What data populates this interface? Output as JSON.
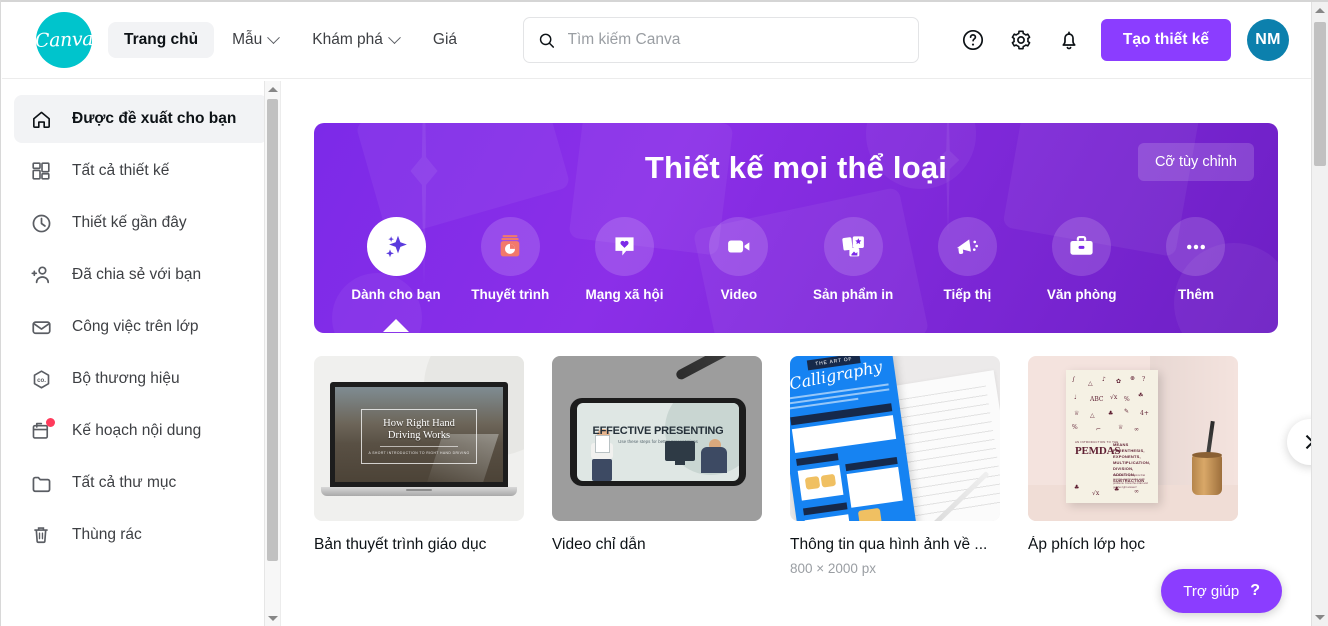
{
  "header": {
    "logo_text": "Canva",
    "nav": [
      {
        "label": "Trang chủ",
        "has_caret": false,
        "active": true
      },
      {
        "label": "Mẫu",
        "has_caret": true,
        "active": false
      },
      {
        "label": "Khám phá",
        "has_caret": true,
        "active": false
      },
      {
        "label": "Giá",
        "has_caret": false,
        "active": false
      }
    ],
    "search": {
      "placeholder": "Tìm kiếm Canva",
      "value": ""
    },
    "help_icon": "question-circle-icon",
    "settings_icon": "gear-icon",
    "notifications_icon": "bell-icon",
    "create_button": "Tạo thiết kế",
    "avatar_initials": "NM",
    "accent_color": "#8b3dff",
    "logo_color": "#00c4cc",
    "avatar_color": "#0c80ad"
  },
  "sidebar": {
    "items": [
      {
        "label": "Được đề xuất cho bạn",
        "icon": "home-icon",
        "active": true,
        "badge": false
      },
      {
        "label": "Tất cả thiết kế",
        "icon": "grid-icon",
        "active": false,
        "badge": false
      },
      {
        "label": "Thiết kế gần đây",
        "icon": "clock-icon",
        "active": false,
        "badge": false
      },
      {
        "label": "Đã chia sẻ với bạn",
        "icon": "add-person-icon",
        "active": false,
        "badge": false
      },
      {
        "label": "Công việc trên lớp",
        "icon": "inbox-icon",
        "active": false,
        "badge": false
      },
      {
        "label": "Bộ thương hiệu",
        "icon": "brand-kit-icon",
        "active": false,
        "badge": false
      },
      {
        "label": "Kế hoạch nội dung",
        "icon": "calendar-plus-icon",
        "active": false,
        "badge": true
      },
      {
        "label": "Tất cả thư mục",
        "icon": "folder-icon",
        "active": false,
        "badge": false
      },
      {
        "label": "Thùng rác",
        "icon": "trash-icon",
        "active": false,
        "badge": false
      }
    ],
    "badge_color": "#ff3b5c"
  },
  "banner": {
    "title": "Thiết kế mọi thể loại",
    "custom_size_button": "Cỡ tùy chỉnh",
    "categories": [
      {
        "label": "Dành cho bạn",
        "icon": "sparkle-icon",
        "selected": true
      },
      {
        "label": "Thuyết trình",
        "icon": "presentation-chart-icon",
        "selected": false
      },
      {
        "label": "Mạng xã hội",
        "icon": "heart-bubble-icon",
        "selected": false
      },
      {
        "label": "Video",
        "icon": "video-camera-icon",
        "selected": false
      },
      {
        "label": "Sản phẩm in",
        "icon": "print-cards-icon",
        "selected": false
      },
      {
        "label": "Tiếp thị",
        "icon": "megaphone-icon",
        "selected": false
      },
      {
        "label": "Văn phòng",
        "icon": "briefcase-icon",
        "selected": false
      },
      {
        "label": "Thêm",
        "icon": "ellipsis-icon",
        "selected": false
      }
    ]
  },
  "cards": [
    {
      "title": "Bản thuyết trình giáo dục",
      "subtitle": "",
      "thumb_kind": "laptop-presentation",
      "thumb_heading": "How Right Hand\nDriving Works",
      "thumb_subtext": "A SHORT INTRODUCTION TO RIGHT HAND DRIVING"
    },
    {
      "title": "Video chỉ dẫn",
      "subtitle": "",
      "thumb_kind": "phone-video",
      "thumb_heading": "EFFECTIVE PRESENTING",
      "thumb_subtext": "Use these steps for better presentations"
    },
    {
      "title": "Thông tin qua hình ảnh về ...",
      "subtitle": "800 × 2000 px",
      "thumb_kind": "calligraphy-flyer",
      "thumb_heading": "THE ART OF",
      "thumb_script": "Calligraphy"
    },
    {
      "title": "Áp phích lớp học",
      "subtitle": "",
      "thumb_kind": "pemdas-poster",
      "thumb_eyebrow": "AN INTRODUCTION TO THE",
      "thumb_heading": "PEMDAS",
      "thumb_body": "MEANS PARENTHESIS, EXPONENTS, MULTIPLICATION, DIVISION, ADDITION, SUBTRACTION",
      "thumb_small": "The order of operations that must be used to solve math problems. Know the order and get the right answer!"
    }
  ],
  "carousel": {
    "next_icon": "chevron-right-icon"
  },
  "help_fab": {
    "label": "Trợ giúp",
    "mark": "?"
  }
}
